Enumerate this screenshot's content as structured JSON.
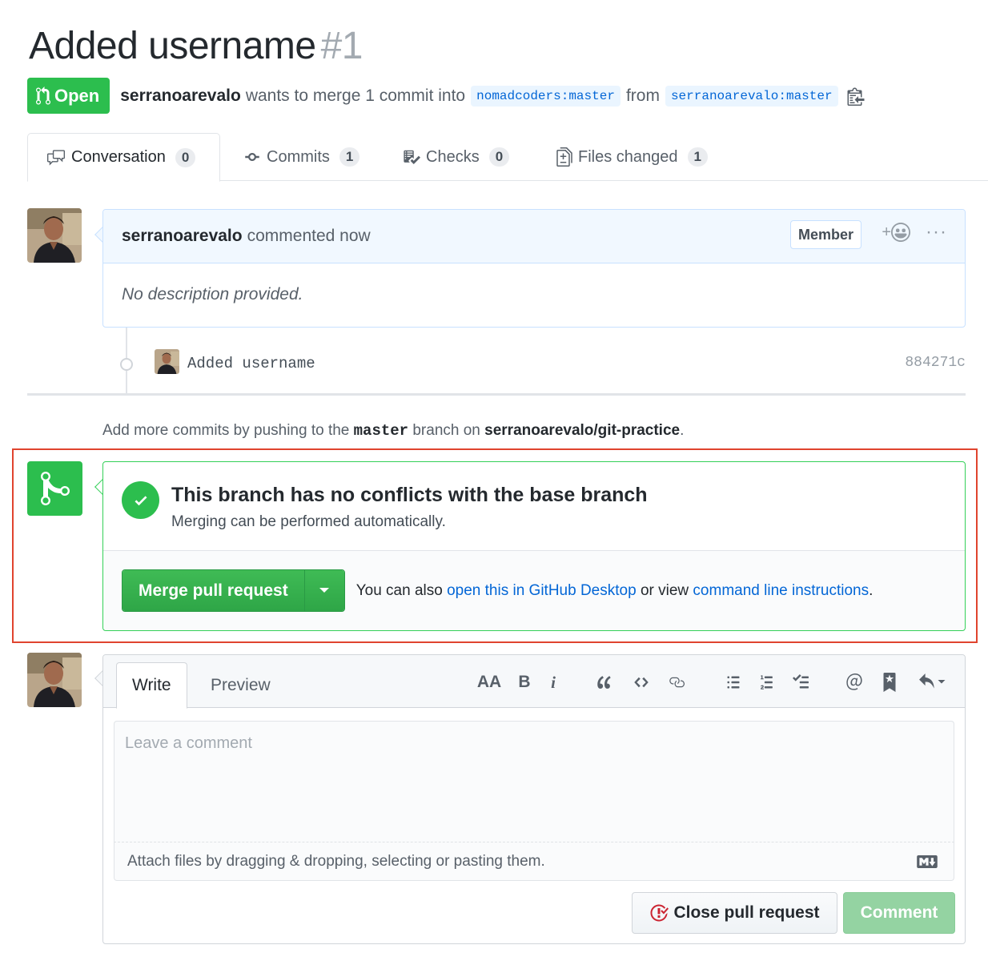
{
  "pr": {
    "title": "Added username",
    "number": "#1",
    "state_label": "Open",
    "author": "serranoarevalo",
    "merge_text": "wants to merge 1 commit into",
    "base_branch": "nomadcoders:master",
    "from_text": "from",
    "head_branch": "serranoarevalo:master"
  },
  "tabs": [
    {
      "label": "Conversation",
      "count": "0",
      "icon": "comment-discussion-icon"
    },
    {
      "label": "Commits",
      "count": "1",
      "icon": "git-commit-icon"
    },
    {
      "label": "Checks",
      "count": "0",
      "icon": "checklist-icon"
    },
    {
      "label": "Files changed",
      "count": "1",
      "icon": "diff-icon"
    }
  ],
  "comment": {
    "author": "serranoarevalo",
    "action": "commented now",
    "badge": "Member",
    "reaction_plus": "+",
    "body": "No description provided."
  },
  "commit": {
    "message": "Added username",
    "sha": "884271c"
  },
  "hint": {
    "prefix": "Add more commits by pushing to the",
    "branch": "master",
    "middle": "branch on",
    "repo": "serranoarevalo/git-practice",
    "suffix": "."
  },
  "merge": {
    "title": "This branch has no conflicts with the base branch",
    "subtitle": "Merging can be performed automatically.",
    "button": "Merge pull request",
    "note_prefix": "You can also",
    "desktop_link": "open this in GitHub Desktop",
    "note_middle": "or view",
    "cli_link": "command line instructions",
    "note_suffix": ".",
    "colors": {
      "accent": "#2cbe4e",
      "frame": "#e0442e"
    }
  },
  "form": {
    "tab_write": "Write",
    "tab_preview": "Preview",
    "toolbar": {
      "heading": "AA",
      "bold": "B",
      "italic": "i"
    },
    "placeholder": "Leave a comment",
    "attach_text": "Attach files by dragging & dropping, selecting or pasting them.",
    "close_button": "Close pull request",
    "comment_button": "Comment"
  }
}
